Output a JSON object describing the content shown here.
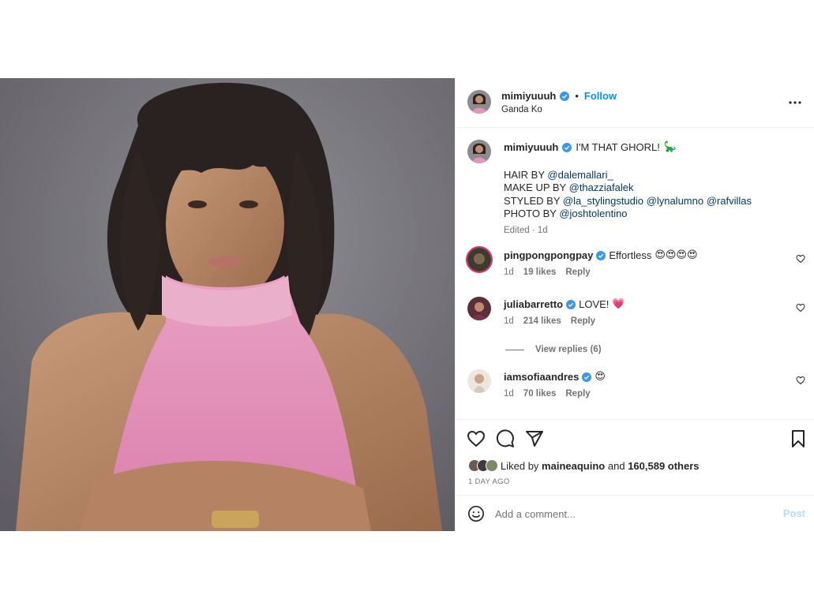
{
  "post": {
    "author": "mimiyuuuh",
    "location": "Ganda Ko",
    "follow_label": "Follow",
    "separator": "•",
    "image_alt": "Portrait of a woman with bangs wearing a pink halter knit top against a grey backdrop"
  },
  "caption": {
    "username": "mimiyuuuh",
    "headline": "I'M THAT GHORL!",
    "headline_emoji": "🦕",
    "lines": [
      {
        "label": "HAIR BY",
        "mentions": [
          "@dalemallari_"
        ]
      },
      {
        "label": "MAKE UP BY",
        "mentions": [
          "@thazziafalek"
        ]
      },
      {
        "label": "STYLED BY",
        "mentions": [
          "@la_stylingstudio",
          "@lynalumno",
          "@rafvillas"
        ]
      },
      {
        "label": "PHOTO BY",
        "mentions": [
          "@joshtolentino"
        ]
      }
    ],
    "meta": "Edited · 1d"
  },
  "comments": [
    {
      "username": "pingpongpongpay",
      "text": "Effortless",
      "emoji": "😍😍😍😍",
      "time": "1d",
      "likes": "19 likes",
      "reply": "Reply",
      "avatar_color": "#3d3a2e"
    },
    {
      "username": "juliabarretto",
      "text": "LOVE!",
      "emoji": "💗",
      "time": "1d",
      "likes": "214 likes",
      "reply": "Reply",
      "avatar_color": "#5a2f3a"
    },
    {
      "username": "iamsofiaandres",
      "text": "",
      "emoji": "😍",
      "time": "1d",
      "likes": "70 likes",
      "reply": "Reply",
      "avatar_color": "#d8c9b8"
    }
  ],
  "view_replies": "View replies (6)",
  "actions": {
    "icons": [
      "heart-icon",
      "comment-icon",
      "share-icon",
      "bookmark-icon"
    ]
  },
  "likes": {
    "prefix": "Liked by",
    "first_user": "maineaquino",
    "and": "and",
    "others": "160,589 others"
  },
  "timestamp": "1 DAY AGO",
  "add_comment": {
    "placeholder": "Add a comment...",
    "post_label": "Post"
  },
  "colors": {
    "accent": "#0095f6",
    "mention": "#00376b",
    "muted": "#737373",
    "verified": "#3897f0",
    "shirt": "#e38fb6"
  }
}
